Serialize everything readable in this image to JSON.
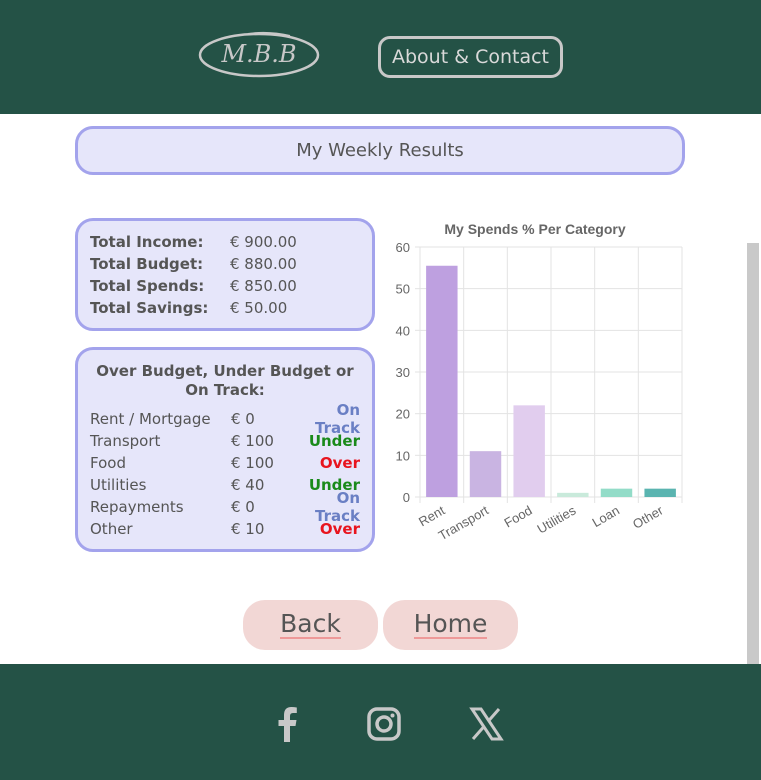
{
  "header": {
    "logo_text": "M.B.B",
    "about_label": "About & Contact"
  },
  "page_title": "My Weekly Results",
  "totals": [
    {
      "label": "Total Income:",
      "value": "€ 900.00"
    },
    {
      "label": "Total Budget:",
      "value": "€ 880.00"
    },
    {
      "label": "Total Spends:",
      "value": "€ 850.00"
    },
    {
      "label": "Total Savings:",
      "value": "€ 50.00"
    }
  ],
  "budget_status": {
    "heading": "Over Budget, Under Budget or On Track:",
    "rows": [
      {
        "category": "Rent / Mortgage",
        "amount": "€ 0",
        "status": "On Track",
        "color": "#6a7fc4"
      },
      {
        "category": "Transport",
        "amount": "€ 100",
        "status": "Under",
        "color": "#1a8a1a"
      },
      {
        "category": "Food",
        "amount": "€ 100",
        "status": "Over",
        "color": "#e8141e"
      },
      {
        "category": "Utilities",
        "amount": "€ 40",
        "status": "Under",
        "color": "#1a8a1a"
      },
      {
        "category": "Repayments",
        "amount": "€ 0",
        "status": "On Track",
        "color": "#6a7fc4"
      },
      {
        "category": "Other",
        "amount": "€ 10",
        "status": "Over",
        "color": "#e8141e"
      }
    ]
  },
  "chart_data": {
    "type": "bar",
    "title": "My Spends % Per Category",
    "categories": [
      "Rent",
      "Transport",
      "Food",
      "Utilities",
      "Loan",
      "Other"
    ],
    "values": [
      55.5,
      11,
      22,
      1,
      2,
      2
    ],
    "colors": [
      "#bea0e0",
      "#c9b4e2",
      "#e1cdee",
      "#c9eadb",
      "#93dcc8",
      "#5ab4b0"
    ],
    "xlabel": "",
    "ylabel": "",
    "ylim": [
      0,
      60
    ],
    "yticks": [
      0,
      10,
      20,
      30,
      40,
      50,
      60
    ],
    "grid": true,
    "legend": "none"
  },
  "nav": {
    "back_label": "Back",
    "home_label": "Home"
  },
  "footer": {
    "icons": [
      "facebook-icon",
      "instagram-icon",
      "x-twitter-icon"
    ]
  }
}
